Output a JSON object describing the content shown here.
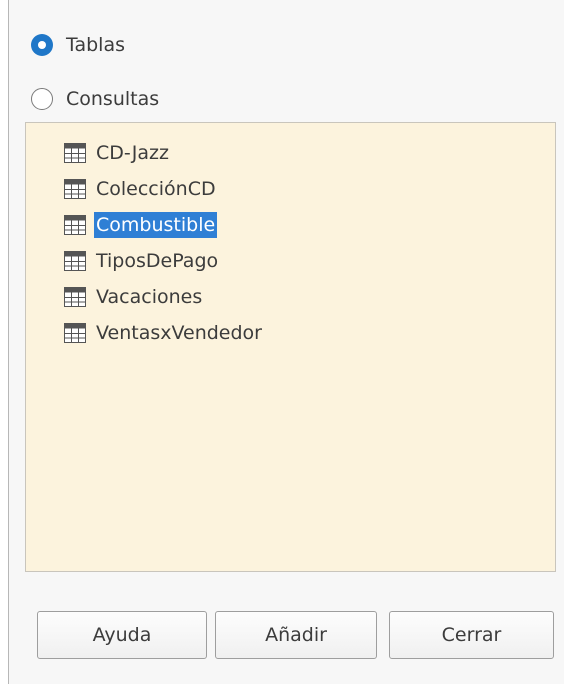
{
  "source": {
    "options": [
      {
        "label": "Tablas",
        "checked": true
      },
      {
        "label": "Consultas",
        "checked": false
      }
    ]
  },
  "list": {
    "items": [
      {
        "label": "CD-Jazz",
        "icon": "table-icon",
        "selected": false
      },
      {
        "label": "ColecciónCD",
        "icon": "table-icon",
        "selected": false
      },
      {
        "label": "Combustible",
        "icon": "table-icon",
        "selected": true
      },
      {
        "label": "TiposDePago",
        "icon": "table-icon",
        "selected": false
      },
      {
        "label": "Vacaciones",
        "icon": "table-icon",
        "selected": false
      },
      {
        "label": "VentasxVendedor",
        "icon": "table-icon",
        "selected": false
      }
    ],
    "background_color": "#fcf3dd",
    "selection_color": "#2f7fd5"
  },
  "buttons": {
    "help": "Ayuda",
    "add": "Añadir",
    "close": "Cerrar"
  },
  "accent_color": "#1f77c8"
}
